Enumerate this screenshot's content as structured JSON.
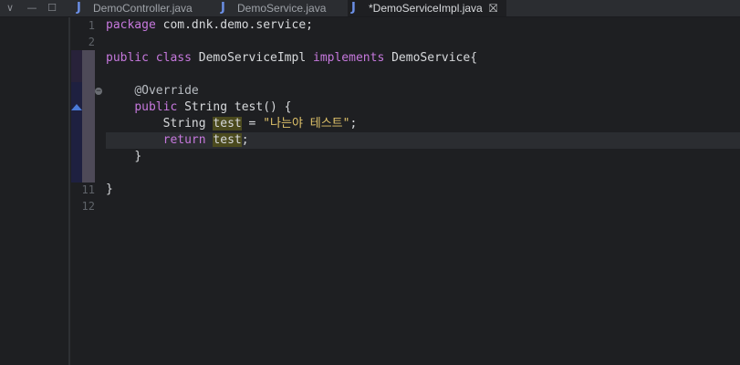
{
  "tabs": [
    {
      "label": "DemoController.java",
      "icon": "java-file-icon",
      "active": false
    },
    {
      "label": "DemoService.java",
      "icon": "java-file-icon",
      "active": false
    },
    {
      "label": "*DemoServiceImpl.java",
      "icon": "java-file-icon",
      "active": true,
      "close": "⛝"
    }
  ],
  "window_controls": {
    "menu": "∨",
    "minimize": "—",
    "maximize": "☐"
  },
  "editor": {
    "line_numbers": [
      "1",
      "2",
      "11",
      "12"
    ],
    "lines": {
      "l1_kw": "package",
      "l1_rest": " com.dnk.demo.service;",
      "l3_kw1": "public",
      "l3_kw2": "class",
      "l3_name": " DemoServiceImpl ",
      "l3_kw3": "implements",
      "l3_rest": " DemoService{",
      "l5_ann": "@Override",
      "l6_kw": "public",
      "l6_rest": " String test() {",
      "l7_type": "String ",
      "l7_var": "test",
      "l7_eq": " = ",
      "l7_str": "\"나는야 테스트\"",
      "l7_end": ";",
      "l8_kw": "return",
      "l8_var": "test",
      "l8_end": ";",
      "l9": "}",
      "l11": "}"
    }
  },
  "colors": {
    "background": "#1e1f22",
    "keyword": "#c678dd",
    "string": "#e0c36a",
    "highlight": "#4b4a1e"
  }
}
